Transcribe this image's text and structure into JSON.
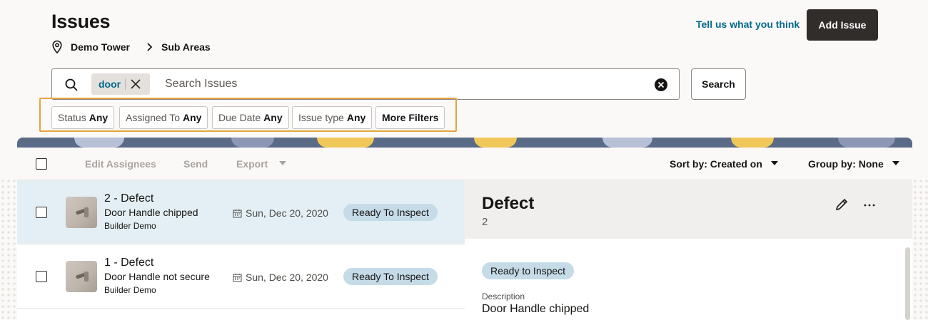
{
  "header": {
    "title": "Issues",
    "breadcrumb": [
      "Demo Tower",
      "Sub Areas"
    ],
    "feedback_link": "Tell us what you think",
    "add_button": "Add Issue"
  },
  "search": {
    "chip": "door",
    "placeholder": "Search Issues",
    "button": "Search"
  },
  "filters": [
    {
      "label": "Status",
      "value": "Any"
    },
    {
      "label": "Assigned To",
      "value": "Any"
    },
    {
      "label": "Due Date",
      "value": "Any"
    },
    {
      "label": "Issue type",
      "value": "Any"
    },
    {
      "label": "More Filters",
      "value": ""
    }
  ],
  "toolbar": {
    "edit_assignees": "Edit Assignees",
    "send": "Send",
    "export": "Export",
    "sort_by": "Sort by: Created on",
    "group_by": "Group by: None"
  },
  "issues": [
    {
      "title": "2 - Defect",
      "subtitle": "Door Handle chipped",
      "owner": "Builder Demo",
      "date": "Sun, Dec 20, 2020",
      "status": "Ready To Inspect"
    },
    {
      "title": "1 - Defect",
      "subtitle": "Door Handle not secure",
      "owner": "Builder Demo",
      "date": "Sun, Dec 20, 2020",
      "status": "Ready To Inspect"
    }
  ],
  "detail": {
    "title": "Defect",
    "id": "2",
    "status": "Ready to Inspect",
    "description_label": "Description",
    "description": "Door Handle chipped"
  },
  "colors": {
    "primary_button": "#312d2a",
    "link": "#00688c",
    "filter_highlight": "#e8a33a",
    "status_pill": "#c5dbe8",
    "selected_row": "#e4eff5"
  }
}
